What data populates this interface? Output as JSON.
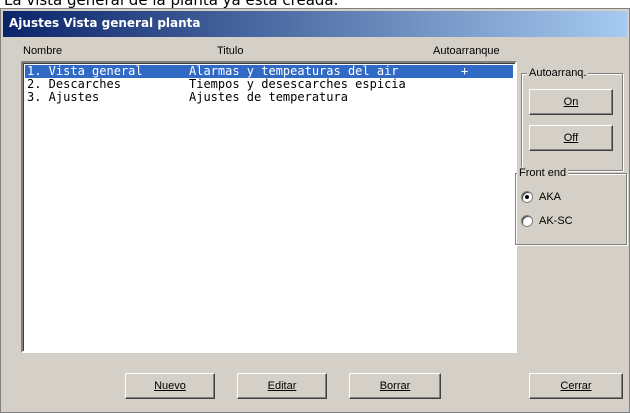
{
  "caption": "La vista general de la planta ya está creada.",
  "window": {
    "title": "Ajustes Vista general planta"
  },
  "list": {
    "columns": [
      "Nombre",
      "Titulo",
      "Autoarranque"
    ],
    "rows": [
      {
        "nombre": "1. Vista general",
        "titulo": "Alarmas y tempeaturas del air",
        "autoarranque": "+",
        "selected": true
      },
      {
        "nombre": "2. Descarches",
        "titulo": "Tiempos y desescarches espicia",
        "autoarranque": "",
        "selected": false
      },
      {
        "nombre": "3. Ajustes",
        "titulo": "Ajustes de temperatura",
        "autoarranque": "",
        "selected": false
      }
    ]
  },
  "autoarranq": {
    "label": "Autoarranq.",
    "on_label": "On",
    "off_label": "Off"
  },
  "front_end": {
    "label": "Front end",
    "options": [
      "AKA",
      "AK-SC"
    ],
    "selected": "AKA"
  },
  "buttons": {
    "nuevo": "Nuevo",
    "editar": "Editar",
    "borrar": "Borrar",
    "cerrar": "Cerrar"
  },
  "colors": {
    "selection": "#316ac5",
    "title_start": "#0a246a",
    "title_end": "#a6caf0",
    "face": "#d4d0c8"
  }
}
